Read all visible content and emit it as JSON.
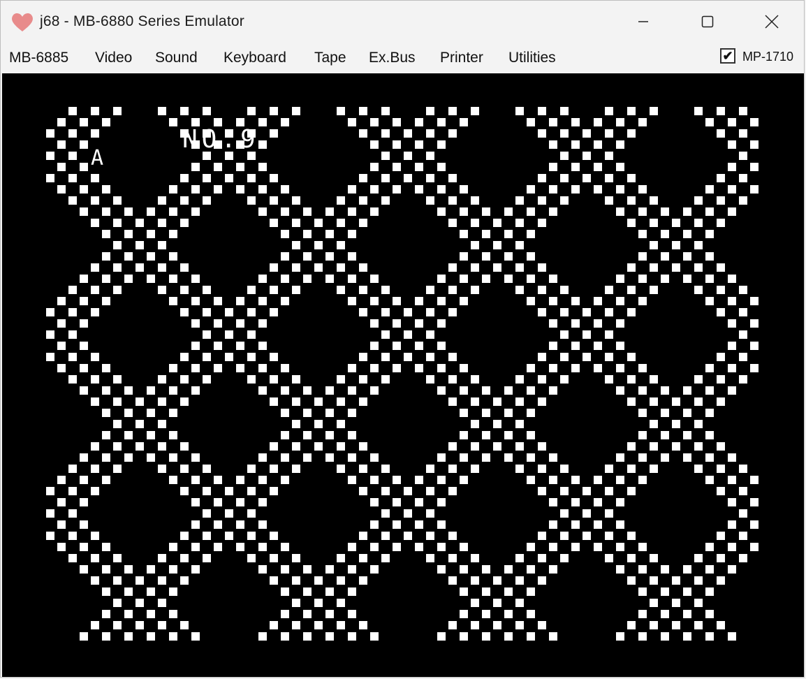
{
  "window": {
    "title": "j68 - MB-6880 Series Emulator",
    "icon": "heart-icon",
    "accent_color": "#e57373"
  },
  "menu": {
    "items": [
      {
        "label": "MB-6885",
        "name": "menu-mb6885"
      },
      {
        "label": "Video",
        "name": "menu-video"
      },
      {
        "label": "Sound",
        "name": "menu-sound"
      },
      {
        "label": "Keyboard",
        "name": "menu-keyboard"
      },
      {
        "label": "Tape",
        "name": "menu-tape"
      },
      {
        "label": "Ex.Bus",
        "name": "menu-exbus"
      },
      {
        "label": "Printer",
        "name": "menu-printer"
      },
      {
        "label": "Utilities",
        "name": "menu-utilities"
      }
    ],
    "mp_checkbox": {
      "label": "MP-1710",
      "checked": true
    }
  },
  "screen": {
    "background": "#000000",
    "foreground": "#ffffff",
    "label_no": "NO.9",
    "label_a": "A"
  }
}
